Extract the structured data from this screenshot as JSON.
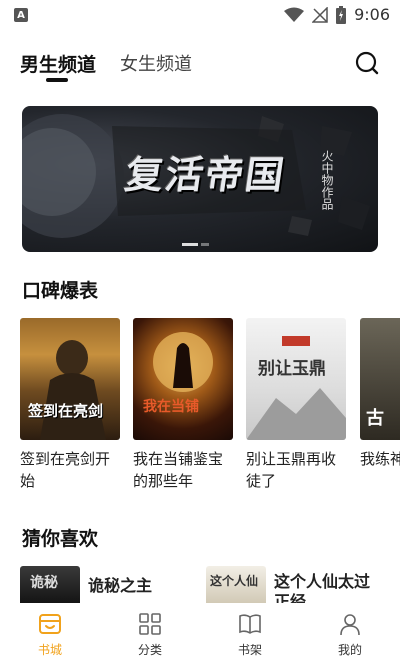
{
  "status_bar": {
    "app_icon_letter": "A",
    "time": "9:06"
  },
  "tabs": {
    "male": "男生频道",
    "female": "女生频道"
  },
  "banner": {
    "title": "复活帝国",
    "author": "火中物作品"
  },
  "sections": {
    "reputation": "口碑爆表",
    "guess": "猜你喜欢"
  },
  "books": [
    {
      "title": "签到在亮剑开始",
      "cover_text": "签到在亮剑"
    },
    {
      "title": "我在当铺鉴宝的那些年",
      "cover_text": "我在当铺"
    },
    {
      "title": "别让玉鼎再收徒了",
      "cover_text": "别让玉鼎"
    },
    {
      "title": "我练神秘",
      "cover_text": "古"
    }
  ],
  "guess_books": [
    {
      "title": "诡秘之主",
      "cover_text": "诡秘"
    },
    {
      "title": "这个人仙太过正经",
      "cover_text": "这个人仙"
    }
  ],
  "bottom_nav": [
    {
      "label": "书城",
      "icon": "bookstore-icon"
    },
    {
      "label": "分类",
      "icon": "category-icon"
    },
    {
      "label": "书架",
      "icon": "bookshelf-icon"
    },
    {
      "label": "我的",
      "icon": "profile-icon"
    }
  ],
  "colors": {
    "accent": "#f1a21b",
    "text_primary": "#111111"
  }
}
